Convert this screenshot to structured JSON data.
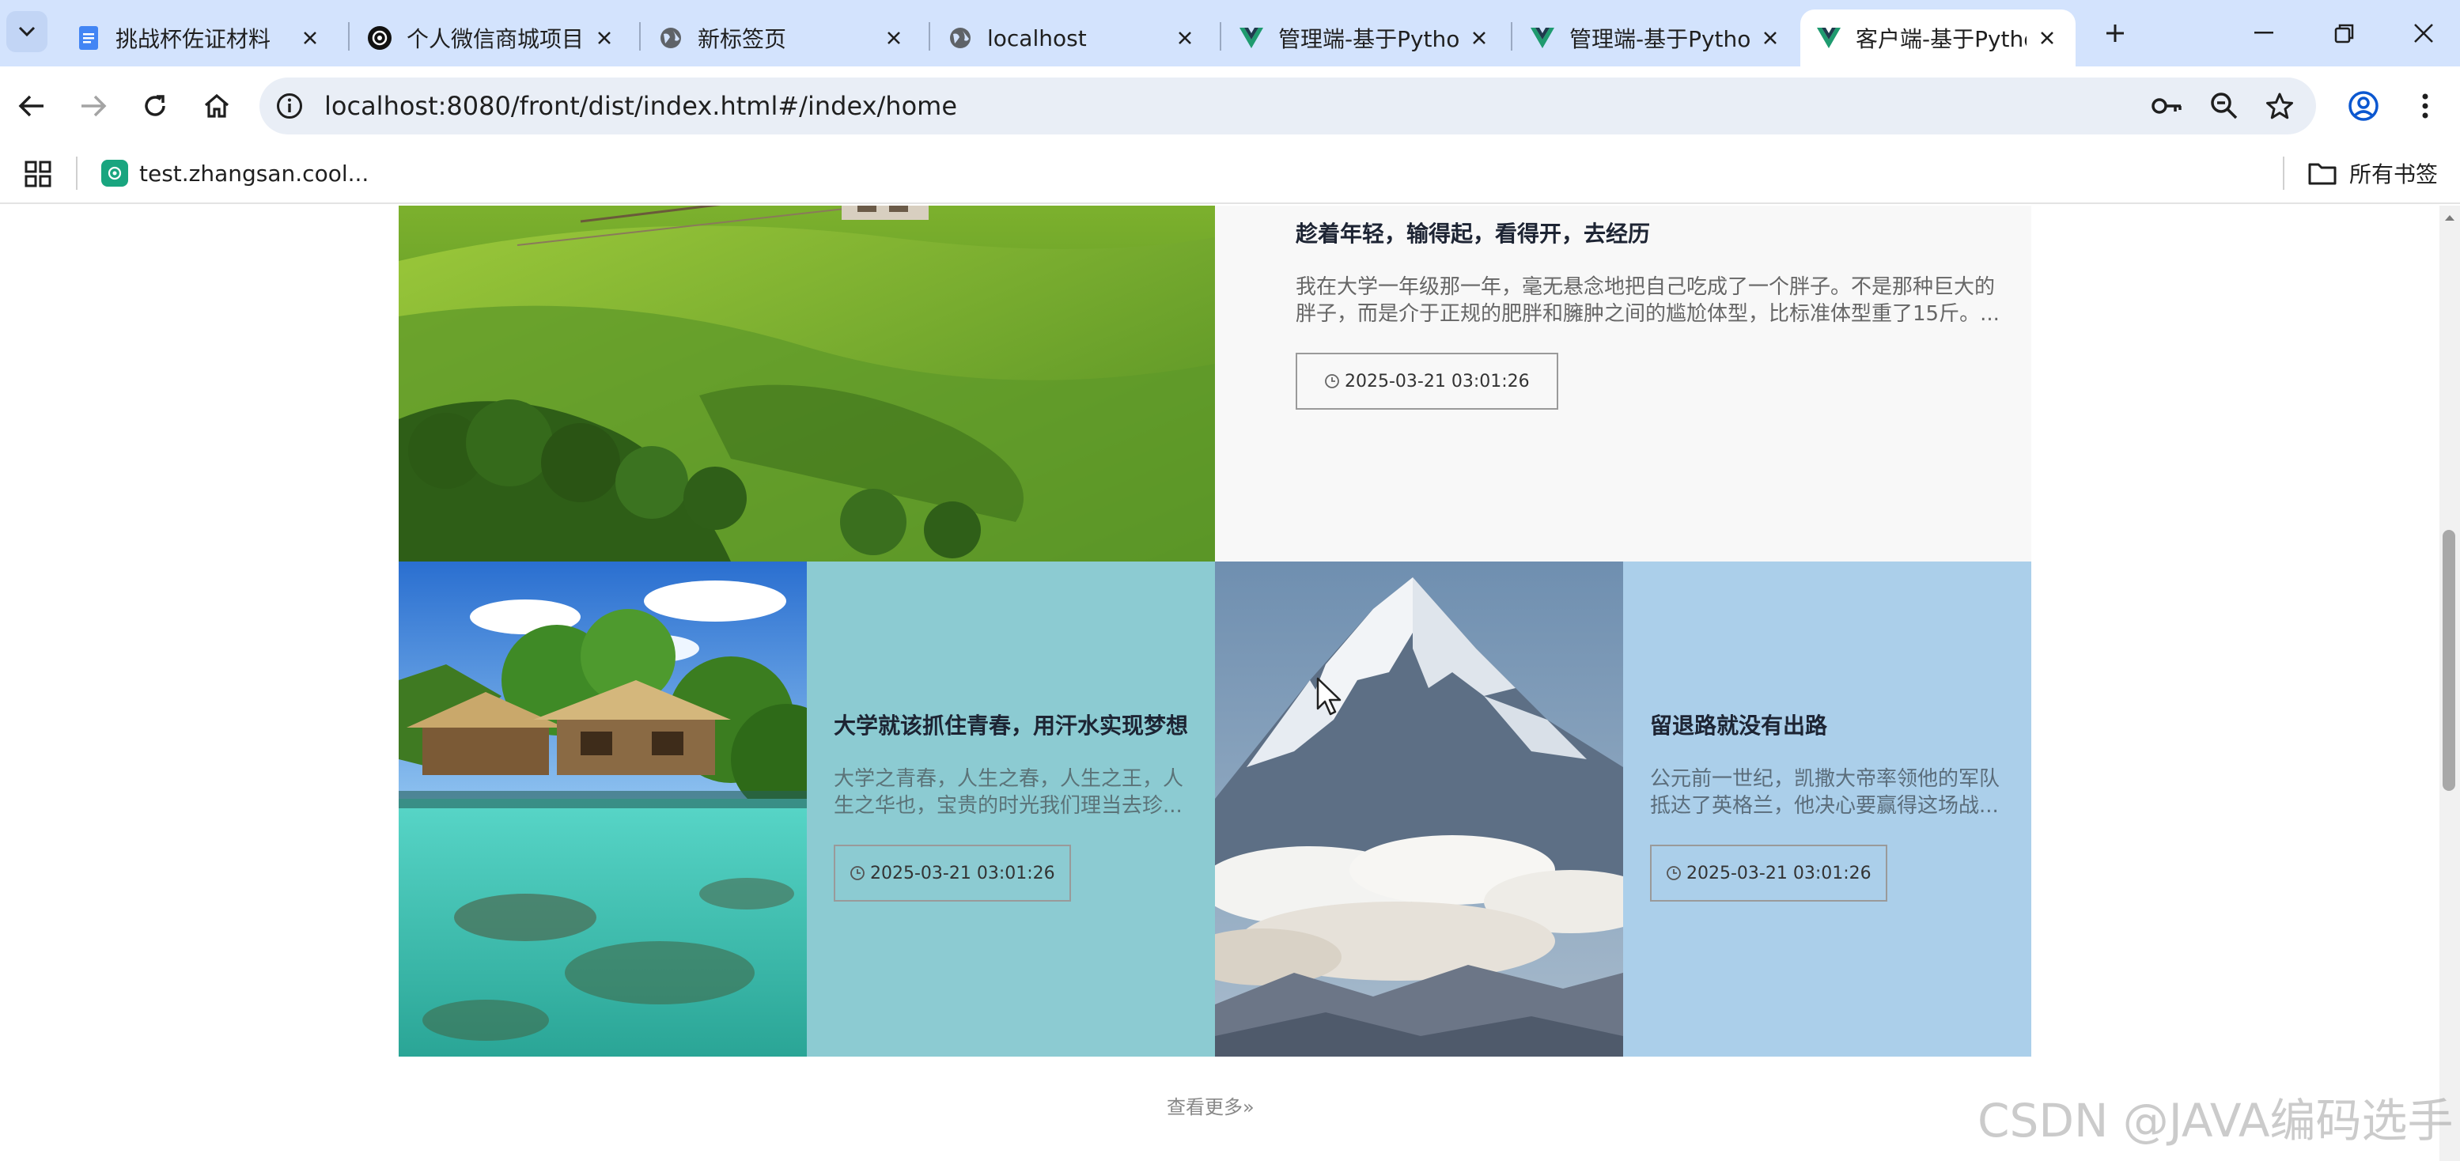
{
  "browser": {
    "tabs": [
      {
        "title": "挑战杯佐证材料",
        "icon": "docs-icon"
      },
      {
        "title": "个人微信商城项目",
        "icon": "chatgpt-icon"
      },
      {
        "title": "新标签页",
        "icon": "globe-icon"
      },
      {
        "title": "localhost",
        "icon": "globe-icon"
      },
      {
        "title": "管理端-基于Pytho",
        "icon": "vue-icon"
      },
      {
        "title": "管理端-基于Pytho",
        "icon": "vue-icon"
      },
      {
        "title": "客户端-基于Pytho",
        "icon": "vue-icon",
        "active": true
      }
    ],
    "url": "localhost:8080/front/dist/index.html#/index/home",
    "bookmarks": [
      {
        "label": "test.zhangsan.cool...",
        "icon": "chatgpt-icon"
      }
    ],
    "all_bookmarks_label": "所有书签"
  },
  "page": {
    "featured": {
      "title": "趁着年轻，输得起，看得开，去经历",
      "excerpt": "我在大学一年级那一年，毫无悬念地把自己吃成了一个胖子。不是那种巨大的胖子，而是介于正规的肥胖和臃肿之间的尴尬体型，比标准体型重了15斤。...",
      "date": "2025-03-21 03:01:26"
    },
    "cards": [
      {
        "title": "大学就该抓住青春，用汗水实现梦想",
        "excerpt": "大学之青春，人生之春，人生之王，人生之华也，宝贵的时光我们理当去珍...",
        "date": "2025-03-21 03:01:26",
        "bg": "#8ccbd2"
      },
      {
        "title": "留退路就没有出路",
        "excerpt": "公元前一世纪，凯撒大帝率领他的军队抵达了英格兰，他决心要赢得这场战...",
        "date": "2025-03-21 03:01:26",
        "bg": "#abcfea"
      }
    ],
    "more_label": "查看更多»"
  },
  "watermark": "CSDN @JAVA编码选手"
}
